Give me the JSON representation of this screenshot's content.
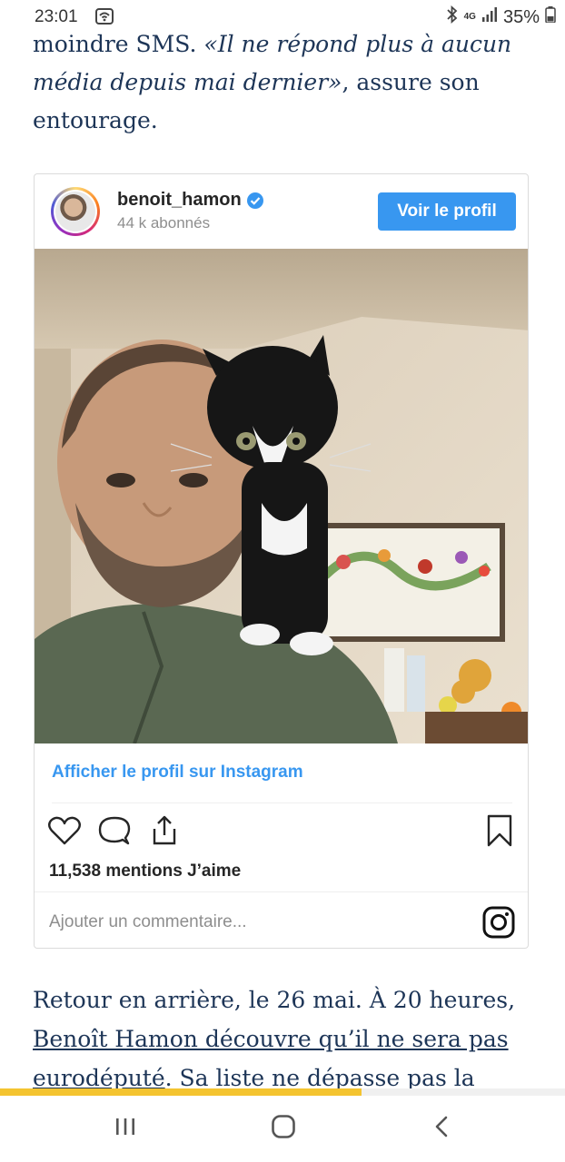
{
  "status_bar": {
    "time": "23:01",
    "network": "4G",
    "battery": "35%"
  },
  "article": {
    "top_text_start": "moindre SMS. ",
    "top_quote": "«Il ne répond plus à aucun média depuis mai dernier»",
    "top_text_end": ", assure son entourage.",
    "bottom_text_start": "Retour en arrière, le 26 mai. À 20 heures, ",
    "bottom_link": "Benoît Hamon découvre qu’il ne sera pas eurodéputé",
    "bottom_text_end": ". Sa liste ne dépasse pas la"
  },
  "instagram_embed": {
    "username": "benoit_hamon",
    "followers": "44 k abonnés",
    "view_profile_button": "Voir le profil",
    "view_on_instagram_link": "Afficher le profil sur Instagram",
    "likes": "11,538 mentions J’aime",
    "comment_placeholder": "Ajouter un commentaire...",
    "icons": [
      "heart-icon",
      "comment-icon",
      "share-icon",
      "bookmark-icon",
      "instagram-logo-icon",
      "verified-icon"
    ],
    "accent_color": "#3897f0"
  },
  "reading_progress": {
    "fraction": 0.64,
    "color": "#f4c430"
  },
  "nav_bar": {
    "icons": [
      "recents-icon",
      "home-icon",
      "back-icon"
    ]
  }
}
